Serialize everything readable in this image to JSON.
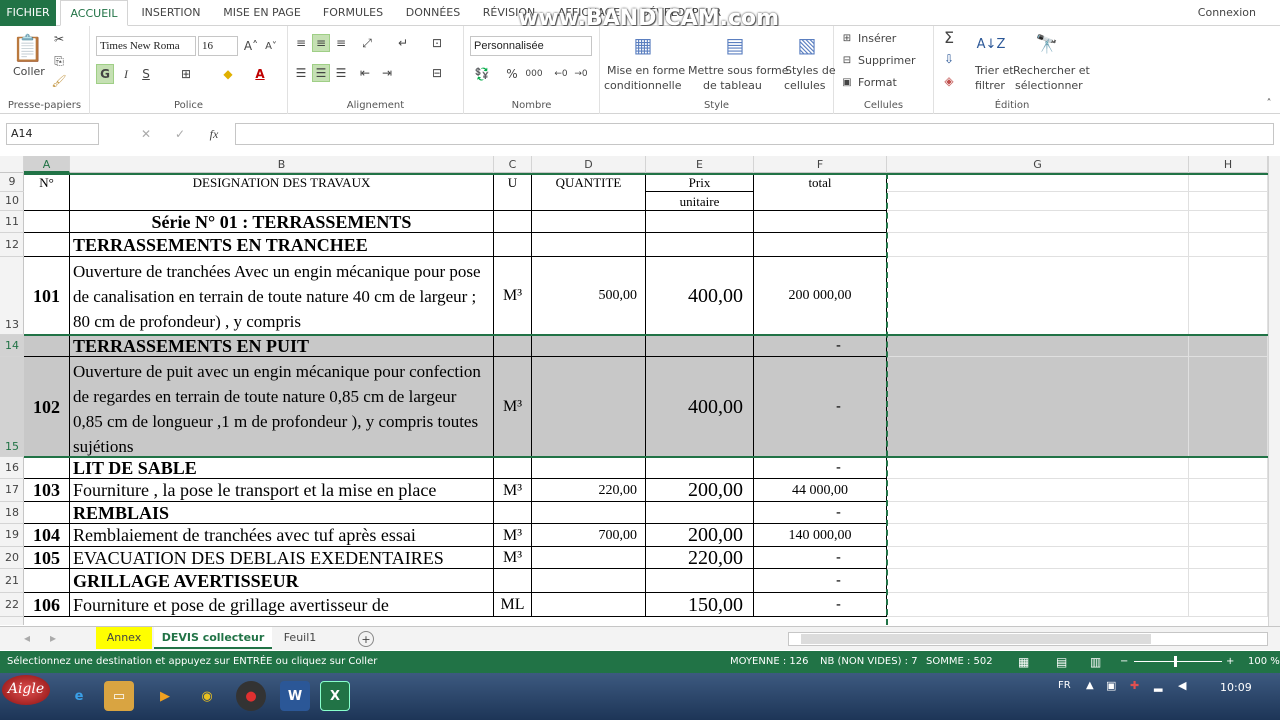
{
  "ribbon_tabs": [
    "FICHIER",
    "ACCUEIL",
    "INSERTION",
    "MISE EN PAGE",
    "FORMULES",
    "DONNÉES",
    "RÉVISION",
    "AFFICHAGE",
    "DÉVELOPPEUR"
  ],
  "account": "Connexion",
  "watermark": "www.BANDICAM.com",
  "ribbon": {
    "paste_label": "Coller",
    "clipboard_group": "Presse-papiers",
    "font_name": "Times New Roma",
    "font_size": "16",
    "bold": "G",
    "italic": "I",
    "underline": "S",
    "font_group": "Police",
    "alignment_group": "Alignement",
    "number_format": "Personnalisée",
    "number_group": "Nombre",
    "percent": "%",
    "thousands": "000",
    "cond_format_1": "Mise en forme",
    "cond_format_2": "conditionnelle",
    "table_format_1": "Mettre sous forme",
    "table_format_2": "de tableau",
    "cell_styles_1": "Styles de",
    "cell_styles_2": "cellules",
    "style_group": "Style",
    "insert": "Insérer",
    "delete": "Supprimer",
    "format": "Format",
    "cells_group": "Cellules",
    "sort_1": "Trier et",
    "sort_2": "filtrer",
    "find_1": "Rechercher et",
    "find_2": "sélectionner",
    "editing_group": "Édition"
  },
  "formula_bar": {
    "name_box": "A14",
    "fx": "fx",
    "value": ""
  },
  "columns": [
    "A",
    "B",
    "C",
    "D",
    "E",
    "F",
    "G",
    "H"
  ],
  "rows": [
    {
      "num": "9",
      "a": "N°",
      "b": "DESIGNATION DES TRAVAUX",
      "c": "U",
      "d": "QUANTITE",
      "e": "Prix",
      "f": "total"
    },
    {
      "num": "10",
      "e": "unitaire"
    },
    {
      "num": "11",
      "b": "Série N° 01 : TERRASSEMENTS"
    },
    {
      "num": "12",
      "b": "TERRASSEMENTS EN TRANCHEE"
    },
    {
      "num": "13",
      "a": "101",
      "b": "  Ouverture  de   tranchées Avec un engin mécanique pour pose de canalisation en terrain de toute nature 40 cm de largeur ; 80 cm de profondeur) , y compris",
      "c": "M³",
      "d": "500,00",
      "e": "400,00",
      "f": "200 000,00"
    },
    {
      "num": "14",
      "b": "TERRASSEMENTS EN PUIT",
      "f": "-"
    },
    {
      "num": "15",
      "a": "102",
      "b": "  Ouverture  de  puit avec un engin mécanique pour confection de regardes en terrain de toute nature 0,85 cm de largeur 0,85 cm de longueur ,1 m de profondeur ), y compris toutes sujétions",
      "c": "M³",
      "e": "400,00",
      "f": "-"
    },
    {
      "num": "16",
      "b": "LIT DE SABLE",
      "f": "-"
    },
    {
      "num": "17",
      "a": "103",
      "b": "Fourniture , la pose le transport et la mise en place",
      "c": "M³",
      "d": "220,00",
      "e": "200,00",
      "f": "44 000,00"
    },
    {
      "num": "18",
      "b": "REMBLAIS",
      "f": "-"
    },
    {
      "num": "19",
      "a": "104",
      "b": "Remblaiement de  tranchées avec tuf après essai",
      "c": "M³",
      "d": "700,00",
      "e": "200,00",
      "f": "140 000,00"
    },
    {
      "num": "20",
      "a": "105",
      "b": "EVACUATION DES DEBLAIS EXEDENTAIRES",
      "c": "M³",
      "e": "220,00",
      "f": "-"
    },
    {
      "num": "21",
      "b": "GRILLAGE AVERTISSEUR",
      "f": "-"
    },
    {
      "num": "22",
      "a": "106",
      "b": " Fourniture et pose  de grillage avertisseur de",
      "c": "ML",
      "e": "150,00",
      "f": "-"
    }
  ],
  "sheet_tabs": [
    "Annex",
    "DEVIS collecteur",
    "Feuil1"
  ],
  "status": {
    "message": "Sélectionnez une destination et appuyez sur ENTRÉE ou cliquez sur Coller",
    "average": "MOYENNE : 126",
    "count": "NB (NON VIDES) : 7",
    "sum": "SOMME : 502",
    "zoom": "100 %"
  },
  "taskbar": {
    "start": "Aigle",
    "lang": "FR",
    "time": "10:09"
  },
  "colors": {
    "excel_green": "#217346",
    "selection_gray": "#c8c8c8",
    "annex_tab": "#ffff00"
  }
}
